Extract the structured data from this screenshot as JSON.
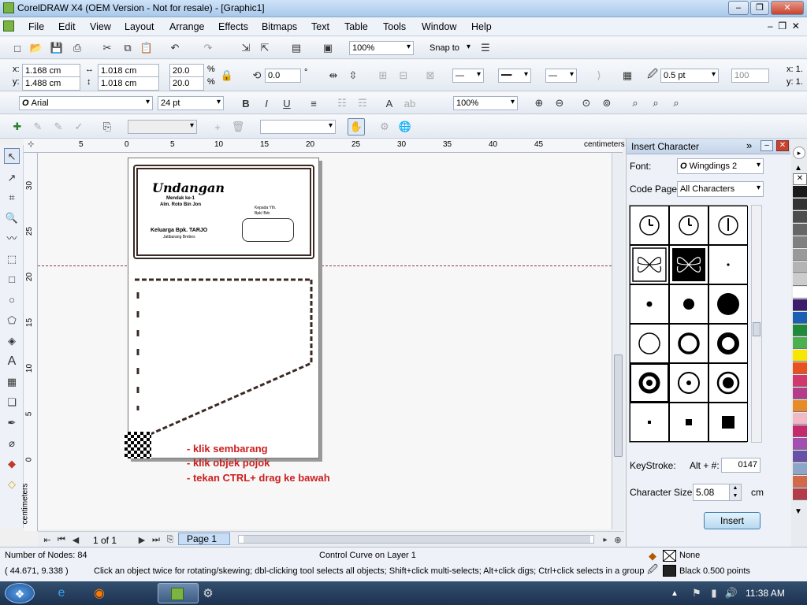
{
  "window": {
    "title": "CorelDRAW X4 (OEM Version - Not for resale) - [Graphic1]"
  },
  "menu": [
    "File",
    "Edit",
    "View",
    "Layout",
    "Arrange",
    "Effects",
    "Bitmaps",
    "Text",
    "Table",
    "Tools",
    "Window",
    "Help"
  ],
  "standard_toolbar": {
    "zoom": "100%",
    "snap_to": "Snap to"
  },
  "property_bar": {
    "x": "1.168 cm",
    "y": "1.488 cm",
    "width": "1.018 cm",
    "height": "1.018 cm",
    "scale_x": "20.0",
    "scale_y": "20.0",
    "percent": "%",
    "rotation": "0.0",
    "degree": "°",
    "outline_width": "0.5 pt",
    "value_100": "100",
    "x_label": "x:",
    "y_label": "y:",
    "right_x": "x: 1.",
    "right_y": "y: 1."
  },
  "text_toolbar": {
    "font": "Arial",
    "size": "24 pt",
    "zoom": "100%"
  },
  "rulers": {
    "top_ticks": [
      "5",
      "0",
      "5",
      "10",
      "15",
      "20",
      "25",
      "30",
      "35",
      "40",
      "45"
    ],
    "unit": "centimeters",
    "left_ticks": [
      "30",
      "25",
      "20",
      "15",
      "10",
      "5",
      "0"
    ],
    "left_unit": "centimeters"
  },
  "page_nav": {
    "counter": "1 of 1",
    "tab": "Page 1"
  },
  "document": {
    "invitation_title": "Undangan",
    "subtitle_1": "Mendak ke-1",
    "subtitle_2": "Alm. Roto Bin Jon",
    "family": "Keluarga Bpk. TARJO",
    "place": "Jatibarang Brebes",
    "to_1": "Kepada Yth.",
    "to_2": "Bpk/ Bdr."
  },
  "annotations": [
    "- klik sembarang",
    "- klik objek pojok",
    "- tekan CTRL+ drag ke bawah"
  ],
  "docker": {
    "title": "Insert Character",
    "font_label": "Font:",
    "font_value": "Wingdings 2",
    "code_page_label": "Code Page:",
    "code_page_value": "All Characters",
    "keystroke_label": "KeyStroke:",
    "keystroke_hint": "Alt + #:",
    "keystroke_value": "0147",
    "size_label": "Character Size:",
    "size_value": "5.08",
    "size_unit": "cm",
    "insert_button": "Insert"
  },
  "palette_colors": [
    "#1a1a1a",
    "#333333",
    "#4d4d4d",
    "#666666",
    "#808080",
    "#999999",
    "#b3b3b3",
    "#cccccc",
    "#ffffff",
    "#3c1c6e",
    "#1b5fb5",
    "#1f8a3a",
    "#4caf50",
    "#f7e600",
    "#e8501e",
    "#d2386c",
    "#b43c88",
    "#e88a2a",
    "#f2b8c6",
    "#c62a6e",
    "#a44fb0",
    "#6a4fa8",
    "#8ea5c8",
    "#d06a4a",
    "#b33b4a"
  ],
  "status": {
    "nodes": "Number of Nodes: 84",
    "object": "Control Curve on Layer 1",
    "coords": "( 44.671, 9.338 )",
    "hint": "Click an object twice for rotating/skewing; dbl-clicking tool selects all objects; Shift+click multi-selects; Alt+click digs; Ctrl+click selects in a group",
    "fill": "None",
    "outline": "Black  0.500 points"
  },
  "taskbar": {
    "time": "11:38 AM"
  },
  "icons": [
    "new-icon",
    "open-icon",
    "save-icon",
    "print-icon",
    "cut-icon",
    "copy-icon",
    "paste-icon",
    "undo-icon",
    "redo-icon",
    "import-icon",
    "export-icon",
    "pick-tool-icon",
    "shape-tool-icon",
    "crop-tool-icon",
    "zoom-tool-icon",
    "freehand-tool-icon",
    "smart-fill-icon",
    "rectangle-tool-icon",
    "ellipse-tool-icon",
    "polygon-tool-icon",
    "basic-shapes-icon",
    "text-tool-icon",
    "table-tool-icon",
    "interactive-effects-icon",
    "eyedropper-icon",
    "outline-tool-icon",
    "fill-tool-icon",
    "interactive-fill-icon"
  ]
}
